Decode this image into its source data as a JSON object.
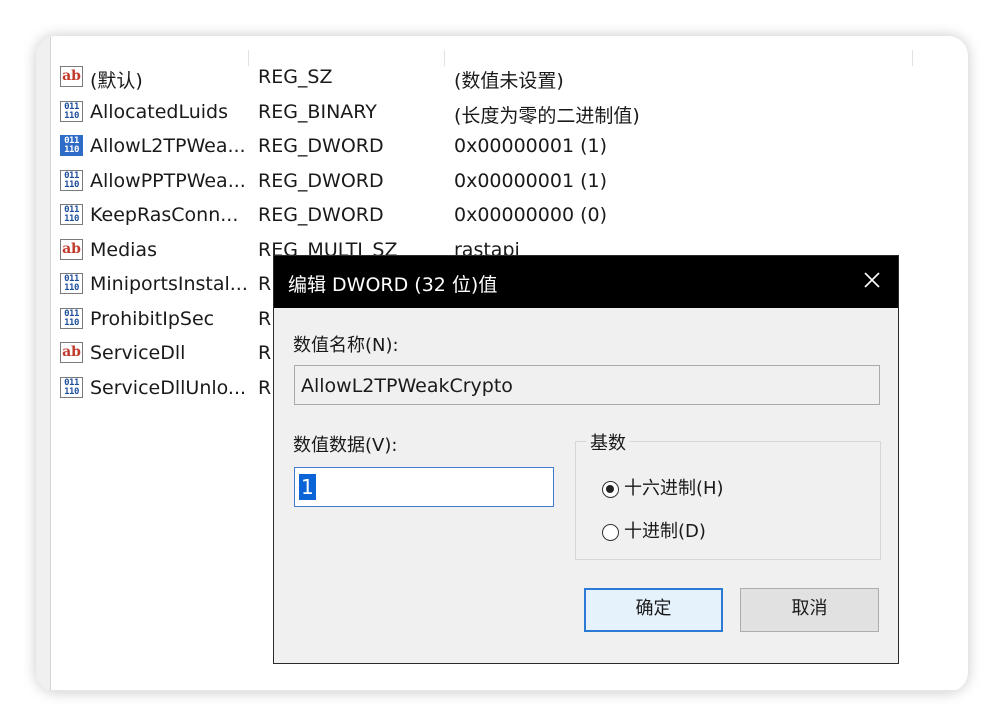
{
  "registry": {
    "rows": [
      {
        "icon": "string-value-icon",
        "icon_text": "ab",
        "name": "(默认)",
        "type": "REG_SZ",
        "data": "(数值未设置)"
      },
      {
        "icon": "binary-value-icon",
        "icon_text": "011\n110",
        "name": "AllocatedLuids",
        "type": "REG_BINARY",
        "data": "(长度为零的二进制值)"
      },
      {
        "icon": "binary-value-icon",
        "icon_text": "011\n110",
        "name": "AllowL2TPWea...",
        "type": "REG_DWORD",
        "data": "0x00000001 (1)",
        "selected_icon": true
      },
      {
        "icon": "binary-value-icon",
        "icon_text": "011\n110",
        "name": "AllowPPTPWea...",
        "type": "REG_DWORD",
        "data": "0x00000001 (1)"
      },
      {
        "icon": "binary-value-icon",
        "icon_text": "011\n110",
        "name": "KeepRasConn...",
        "type": "REG_DWORD",
        "data": "0x00000000 (0)"
      },
      {
        "icon": "string-value-icon",
        "icon_text": "ab",
        "name": "Medias",
        "type": "REG_MULTI_SZ",
        "data": "rastapi"
      },
      {
        "icon": "binary-value-icon",
        "icon_text": "011\n110",
        "name": "MiniportsInstal...",
        "type": "R",
        "data": ""
      },
      {
        "icon": "binary-value-icon",
        "icon_text": "011\n110",
        "name": "ProhibitIpSec",
        "type": "R",
        "data": ""
      },
      {
        "icon": "string-value-icon",
        "icon_text": "ab",
        "name": "ServiceDll",
        "type": "R",
        "data": ""
      },
      {
        "icon": "binary-value-icon",
        "icon_text": "011\n110",
        "name": "ServiceDllUnlo...",
        "type": "R",
        "data": ""
      }
    ]
  },
  "dialog": {
    "title": "编辑 DWORD (32 位)值",
    "name_label": "数值名称(N):",
    "name_value": "AllowL2TPWeakCrypto",
    "data_label": "数值数据(V):",
    "data_value": "1",
    "base_legend": "基数",
    "hex_label": "十六进制(H)",
    "dec_label": "十进制(D)",
    "hex_checked": true,
    "ok_label": "确定",
    "cancel_label": "取消"
  },
  "colors": {
    "titlebar": "#000000",
    "dialog_bg": "#f0f0f0",
    "accent": "#0a64d8"
  }
}
